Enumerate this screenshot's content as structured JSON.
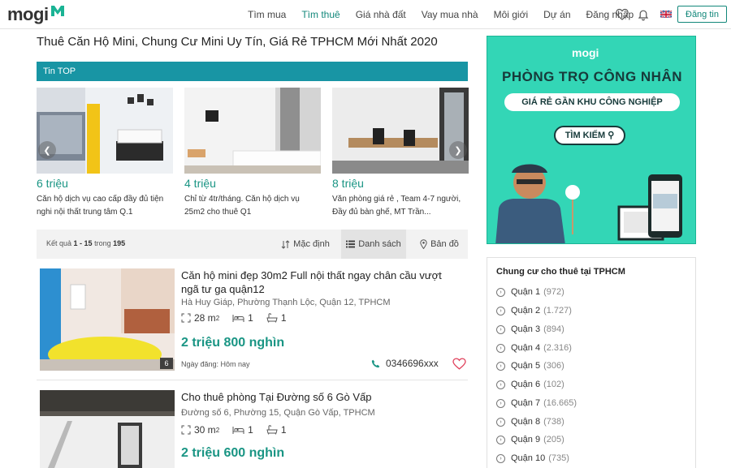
{
  "header": {
    "logo_text": "mogi",
    "nav": [
      "Tìm mua",
      "Tìm thuê",
      "Giá nhà đất",
      "Vay mua nhà",
      "Môi giới",
      "Dự án",
      "Đăng nhập"
    ],
    "active_nav": "Tìm thuê",
    "post_button": "Đăng tin",
    "accent_color": "#12877a"
  },
  "page_title": "Thuê Căn Hộ Mini, Chung Cư Mini Uy Tín, Giá Rẻ TPHCM Mới Nhất 2020",
  "top_section": {
    "label": "Tin TOP",
    "cards": [
      {
        "price": "6 triệu",
        "desc": "Căn hộ dịch vụ cao cấp đầy đủ tiện nghi nội thất trung tâm Q.1"
      },
      {
        "price": "4 triệu",
        "desc": "Chỉ từ 4tr/tháng. Căn hộ dịch vụ 25m2 cho thuê Q1"
      },
      {
        "price": "8 triệu",
        "desc": "Văn phòng giá rẻ , Team 4-7 người, Đầy đủ bàn ghế, MT Trần..."
      }
    ]
  },
  "results": {
    "prefix": "Kết quả",
    "range": "1 - 15",
    "of": "trong",
    "total": "195",
    "views": [
      "Mặc định",
      "Danh sách",
      "Bản đồ"
    ],
    "active_view": "Danh sách"
  },
  "listings": [
    {
      "title": "Căn hộ mini đẹp 30m2 Full nội thất ngay chân cầu vượt ngã tư ga quận12",
      "address": "Hà Huy Giáp, Phường Thạnh Lộc, Quận 12, TPHCM",
      "area": "28 m",
      "area_sup": "2",
      "bedrooms": "1",
      "bathrooms": "1",
      "price": "2 triệu 800 nghìn",
      "date": "Ngày đăng: Hôm nay",
      "phone": "0346696xxx",
      "image_count": "6"
    },
    {
      "title": "Cho thuê phòng Tại Đường số 6 Gò Vấp",
      "address": "Đường số 6, Phường 15, Quận Gò Vấp, TPHCM",
      "area": "30 m",
      "area_sup": "2",
      "bedrooms": "1",
      "bathrooms": "1",
      "price": "2 triệu 600 nghìn"
    }
  ],
  "ad": {
    "logo": "mogi",
    "headline": "PHÒNG TRỌ CÔNG NHÂN",
    "subline": "GIÁ RẺ GẦN KHU CÔNG NGHIỆP",
    "button": "TÌM KIẾM",
    "bg_color": "#33d6b6"
  },
  "sidebar": {
    "title": "Chung cư cho thuê tại TPHCM",
    "items": [
      {
        "name": "Quận 1",
        "count": "(972)"
      },
      {
        "name": "Quận 2",
        "count": "(1.727)"
      },
      {
        "name": "Quận 3",
        "count": "(894)"
      },
      {
        "name": "Quận 4",
        "count": "(2.316)"
      },
      {
        "name": "Quận 5",
        "count": "(306)"
      },
      {
        "name": "Quận 6",
        "count": "(102)"
      },
      {
        "name": "Quận 7",
        "count": "(16.665)"
      },
      {
        "name": "Quận 8",
        "count": "(738)"
      },
      {
        "name": "Quận 9",
        "count": "(205)"
      },
      {
        "name": "Quận 10",
        "count": "(735)"
      }
    ]
  }
}
